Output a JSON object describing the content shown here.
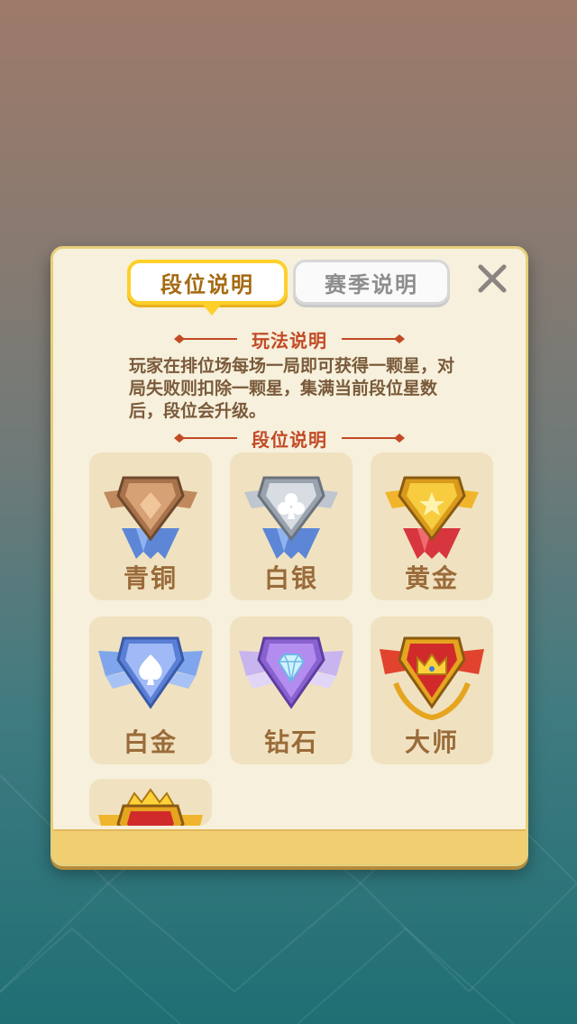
{
  "tabs": {
    "active_label": "段位说明",
    "inactive_label": "赛季说明"
  },
  "sections": {
    "rules_title": "玩法说明",
    "rules_text": "玩家在排位场每场一局即可获得一颗星，对局失败则扣除一颗星，集满当前段位星数后，段位会升级。",
    "ranks_title": "段位说明"
  },
  "ranks": [
    {
      "label": "青铜",
      "icon": "diamond-shield-icon"
    },
    {
      "label": "白银",
      "icon": "club-shield-icon"
    },
    {
      "label": "黄金",
      "icon": "star-shield-icon"
    },
    {
      "label": "白金",
      "icon": "spade-shield-icon"
    },
    {
      "label": "钻石",
      "icon": "gem-shield-icon"
    },
    {
      "label": "大师",
      "icon": "crown-shield-icon"
    },
    {
      "label": "",
      "icon": "crowned-shield-icon"
    }
  ],
  "colors": {
    "accent_gold": "#ffcf2a",
    "title_red": "#c24a25",
    "panel_bg": "#f6f0dc",
    "tile_bg": "#f0e2c0"
  }
}
